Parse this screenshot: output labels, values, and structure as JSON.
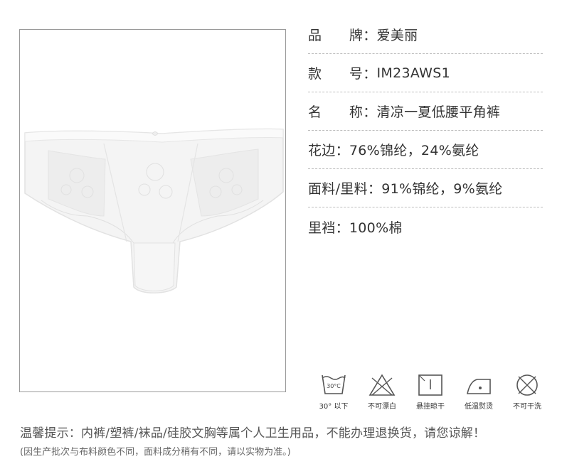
{
  "specs": [
    {
      "label": "品　　牌：",
      "value": "爱美丽"
    },
    {
      "label": "款　　号：",
      "value": "IM23AWS1"
    },
    {
      "label": "名　　称：",
      "value": "清凉一夏低腰平角裤"
    },
    {
      "label": "花边：",
      "value": "76%锦纶，24%氨纶"
    },
    {
      "label": "面料/里料：",
      "value": "91%锦纶，9%氨纶"
    },
    {
      "label": "里裆：",
      "value": "100%棉"
    }
  ],
  "care": [
    {
      "icon": "wash-30-icon",
      "label": "30° 以下",
      "temp": "30°C"
    },
    {
      "icon": "no-bleach-icon",
      "label": "不可漂白"
    },
    {
      "icon": "hang-dry-shade-icon",
      "label": "悬挂晾干"
    },
    {
      "icon": "low-iron-icon",
      "label": "低温熨烫"
    },
    {
      "icon": "no-dry-clean-icon",
      "label": "不可干洗"
    }
  ],
  "notice": "温馨提示：内裤/塑裤/袜品/硅胶文胸等属个人卫生用品，不能办理退换货，请您谅解！",
  "notice_sub": "(因生产批次与布料颜色不同，面料成分稍有不同，请以实物为准。)"
}
